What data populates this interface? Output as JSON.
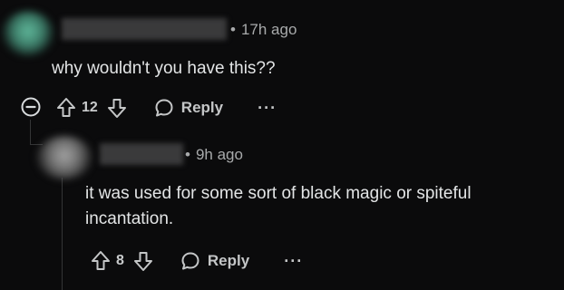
{
  "comments": [
    {
      "time": "17h ago",
      "text": "why wouldn't you have this??",
      "score": "12",
      "reply_label": "Reply",
      "more_label": "···"
    },
    {
      "time": "9h ago",
      "text_line1": "it was used for some sort of black magic or spiteful",
      "text_line2": "incantation.",
      "score": "8",
      "reply_label": "Reply",
      "more_label": "···"
    }
  ],
  "icons": {
    "collapse": "minus-circle-icon",
    "upvote": "arrow-up-icon",
    "downvote": "arrow-down-icon",
    "reply": "speech-bubble-icon",
    "more": "ellipsis-icon"
  }
}
